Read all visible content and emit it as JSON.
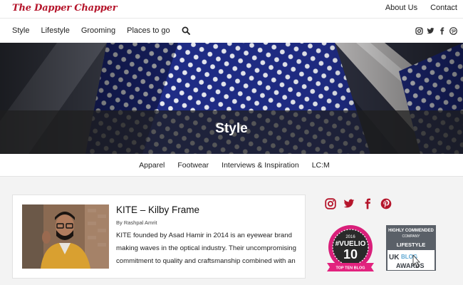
{
  "site": {
    "logo": "The Dapper Chapper"
  },
  "top_links": [
    "About Us",
    "Contact"
  ],
  "nav": {
    "items": [
      "Style",
      "Lifestyle",
      "Grooming",
      "Places to go"
    ]
  },
  "hero": {
    "title": "Style"
  },
  "subnav": {
    "items": [
      "Apparel",
      "Footwear",
      "Interviews & Inspiration",
      "LC:M"
    ]
  },
  "post": {
    "title": "KITE – Kilby Frame",
    "byline": "By Rashpal Amrit",
    "excerpt": "KITE founded by Asad Hamir in 2014 is an eyewear brand making waves in the optical industry. Their uncompromising commitment to quality and craftsmanship combined with an"
  },
  "badges": {
    "vuelio": {
      "year": "2016",
      "brand": "#VUELIO",
      "number": "10",
      "ribbon": "TOP TEN BLOG"
    },
    "uk": {
      "line1": "HIGHLY COMMENDED",
      "line2": "COMPANY",
      "line3": "LIFESTYLE",
      "uk": "UK",
      "blog": "BLOG",
      "awards": "AWARDS"
    }
  },
  "colors": {
    "brand": "#b5152b",
    "text": "#222222",
    "hero_band": "#1e1e1e"
  },
  "icons": [
    "search-icon",
    "instagram-icon",
    "twitter-icon",
    "facebook-icon",
    "pinterest-icon"
  ]
}
